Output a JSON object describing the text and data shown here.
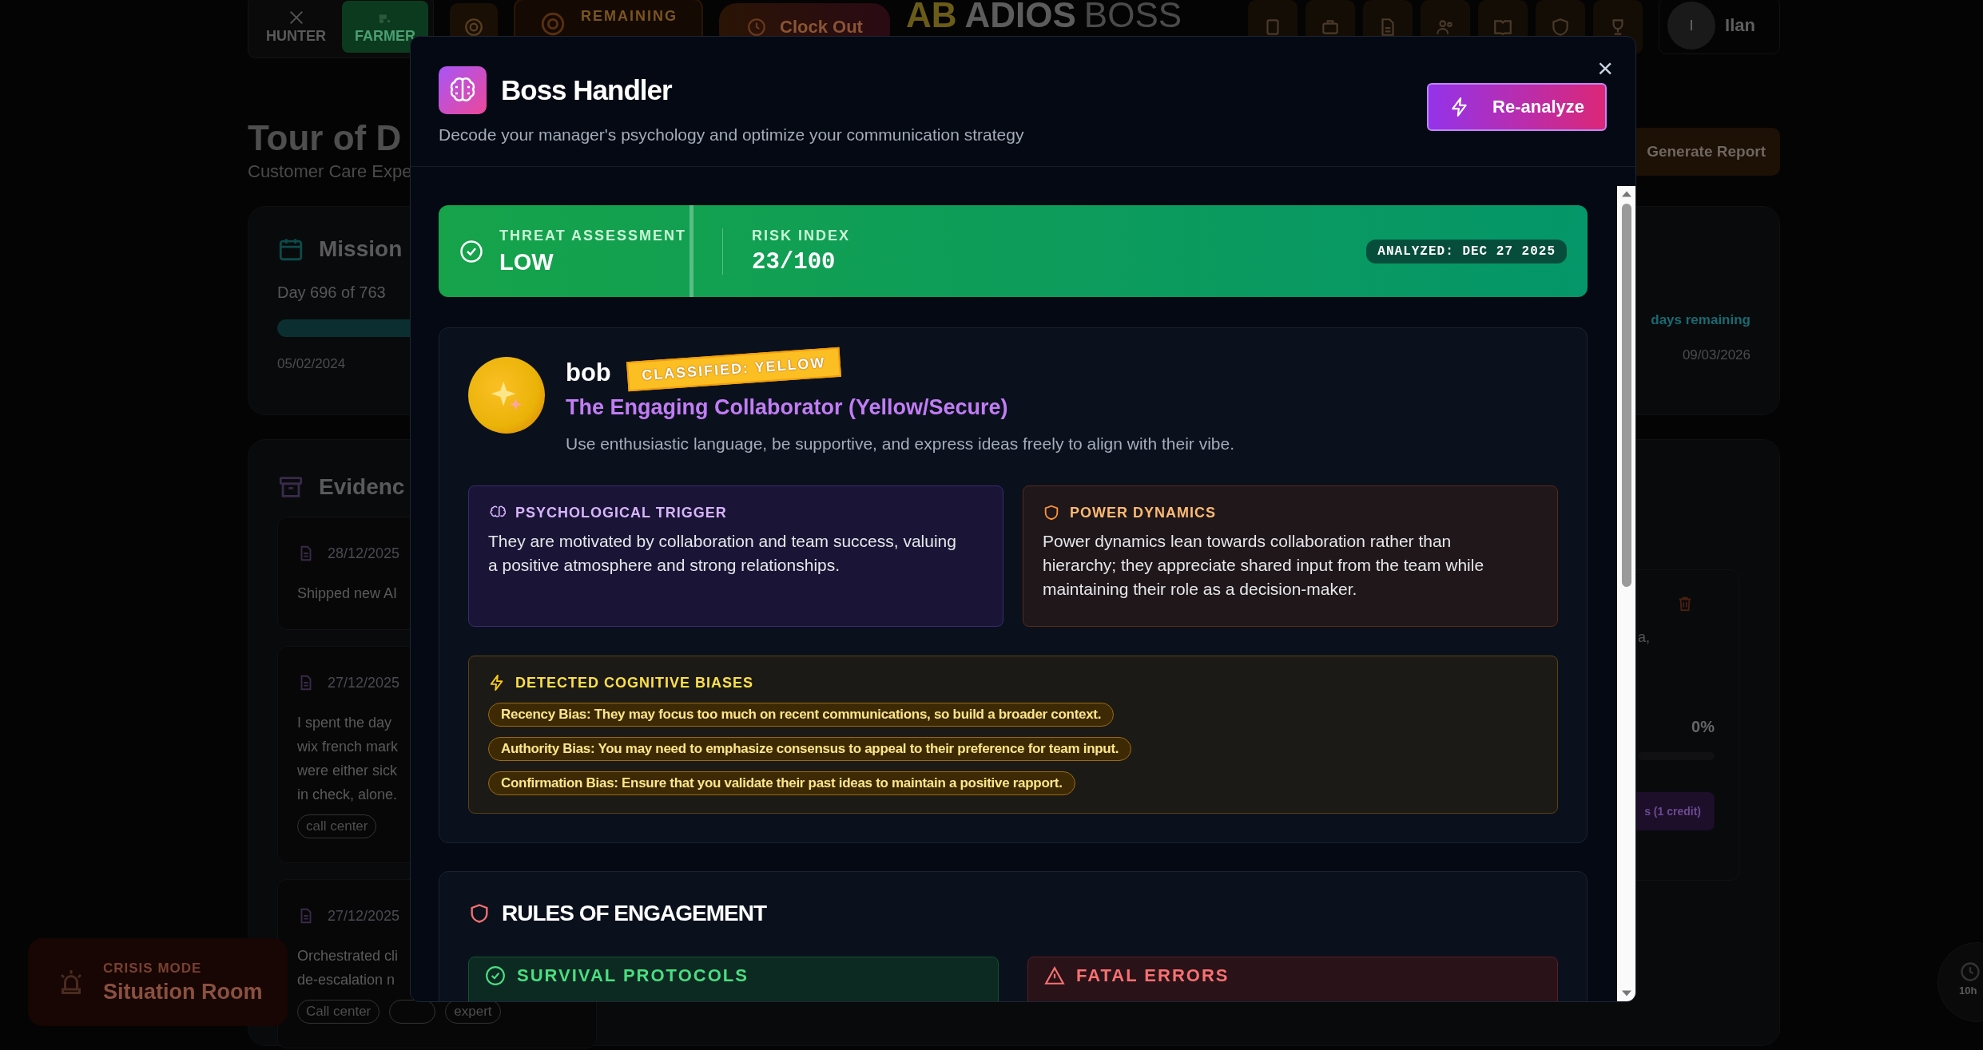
{
  "top_bar": {
    "modes": [
      {
        "label": "HUNTER",
        "selected": false
      },
      {
        "label": "FARMER",
        "selected": true
      }
    ],
    "remaining_label": "REMAINING",
    "clock_out": "Clock Out",
    "logo": {
      "mark": "AB",
      "name": "ADIOS",
      "accent": "BOSS"
    },
    "user": {
      "initial": "I",
      "name": "Ilan"
    }
  },
  "page": {
    "title": "Tour of D",
    "subtitle": "Customer Care Expe",
    "report_button": "Generate Report"
  },
  "mission": {
    "title": "Mission",
    "day": "Day 696 of 763",
    "level": 0.91,
    "start": "05/02/2024",
    "remaining": "days remaining",
    "end": "09/03/2026"
  },
  "evidence": {
    "title": "Evidenc",
    "entries": [
      {
        "date": "28/12/2025",
        "lines": [
          "Shipped new AI"
        ]
      },
      {
        "date": "27/12/2025",
        "lines": [
          "I spent the day",
          "wix french mark",
          "were either sick",
          "in check, alone."
        ],
        "tags": [
          "call center"
        ]
      },
      {
        "date": "27/12/2025",
        "lines": [
          "Orchestrated cli",
          "de-escalation n"
        ],
        "tags": [
          "Call center",
          "expert"
        ]
      }
    ],
    "side_card": {
      "fragment": "a,",
      "percent": "0%",
      "level": 0,
      "button": "s (1 credit)"
    }
  },
  "crisis": {
    "label": "CRISIS MODE",
    "title": "Situation Room"
  },
  "timer": "10h",
  "modal": {
    "title": "Boss Handler",
    "subtitle": "Decode your manager's psychology and optimize your communication strategy",
    "reanalyze": "Re-analyze",
    "close": "×",
    "threat": {
      "label": "THREAT ASSESSMENT",
      "value": "LOW",
      "risk_label": "RISK INDEX",
      "risk_value": "23/100",
      "analyzed": "ANALYZED: DEC 27 2025"
    },
    "profile": {
      "name": "bob",
      "badge": "CLASSIFIED: YELLOW",
      "archetype": "The Engaging Collaborator (Yellow/Secure)",
      "advice": "Use enthusiastic language, be supportive, and express ideas freely to align with their vibe.",
      "insights": [
        {
          "kind": "trigger",
          "title": "PSYCHOLOGICAL TRIGGER",
          "text": "They are motivated by collaboration and team success, valuing a positive atmosphere and strong relationships."
        },
        {
          "kind": "power",
          "title": "POWER DYNAMICS",
          "text": "Power dynamics lean towards collaboration rather than hierarchy; they appreciate shared input from the team while maintaining their role as a decision-maker."
        }
      ],
      "biases_title": "DETECTED COGNITIVE BIASES",
      "biases": [
        "Recency Bias: They may focus too much on recent communications, so build a broader context.",
        "Authority Bias: You may need to emphasize consensus to appeal to their preference for team input.",
        "Confirmation Bias: Ensure that you validate their past ideas to maintain a positive rapport."
      ]
    },
    "rules": {
      "title": "RULES OF ENGAGEMENT",
      "sections": [
        {
          "kind": "do",
          "title": "SURVIVAL PROTOCOLS"
        },
        {
          "kind": "dont",
          "title": "FATAL ERRORS"
        }
      ]
    }
  }
}
